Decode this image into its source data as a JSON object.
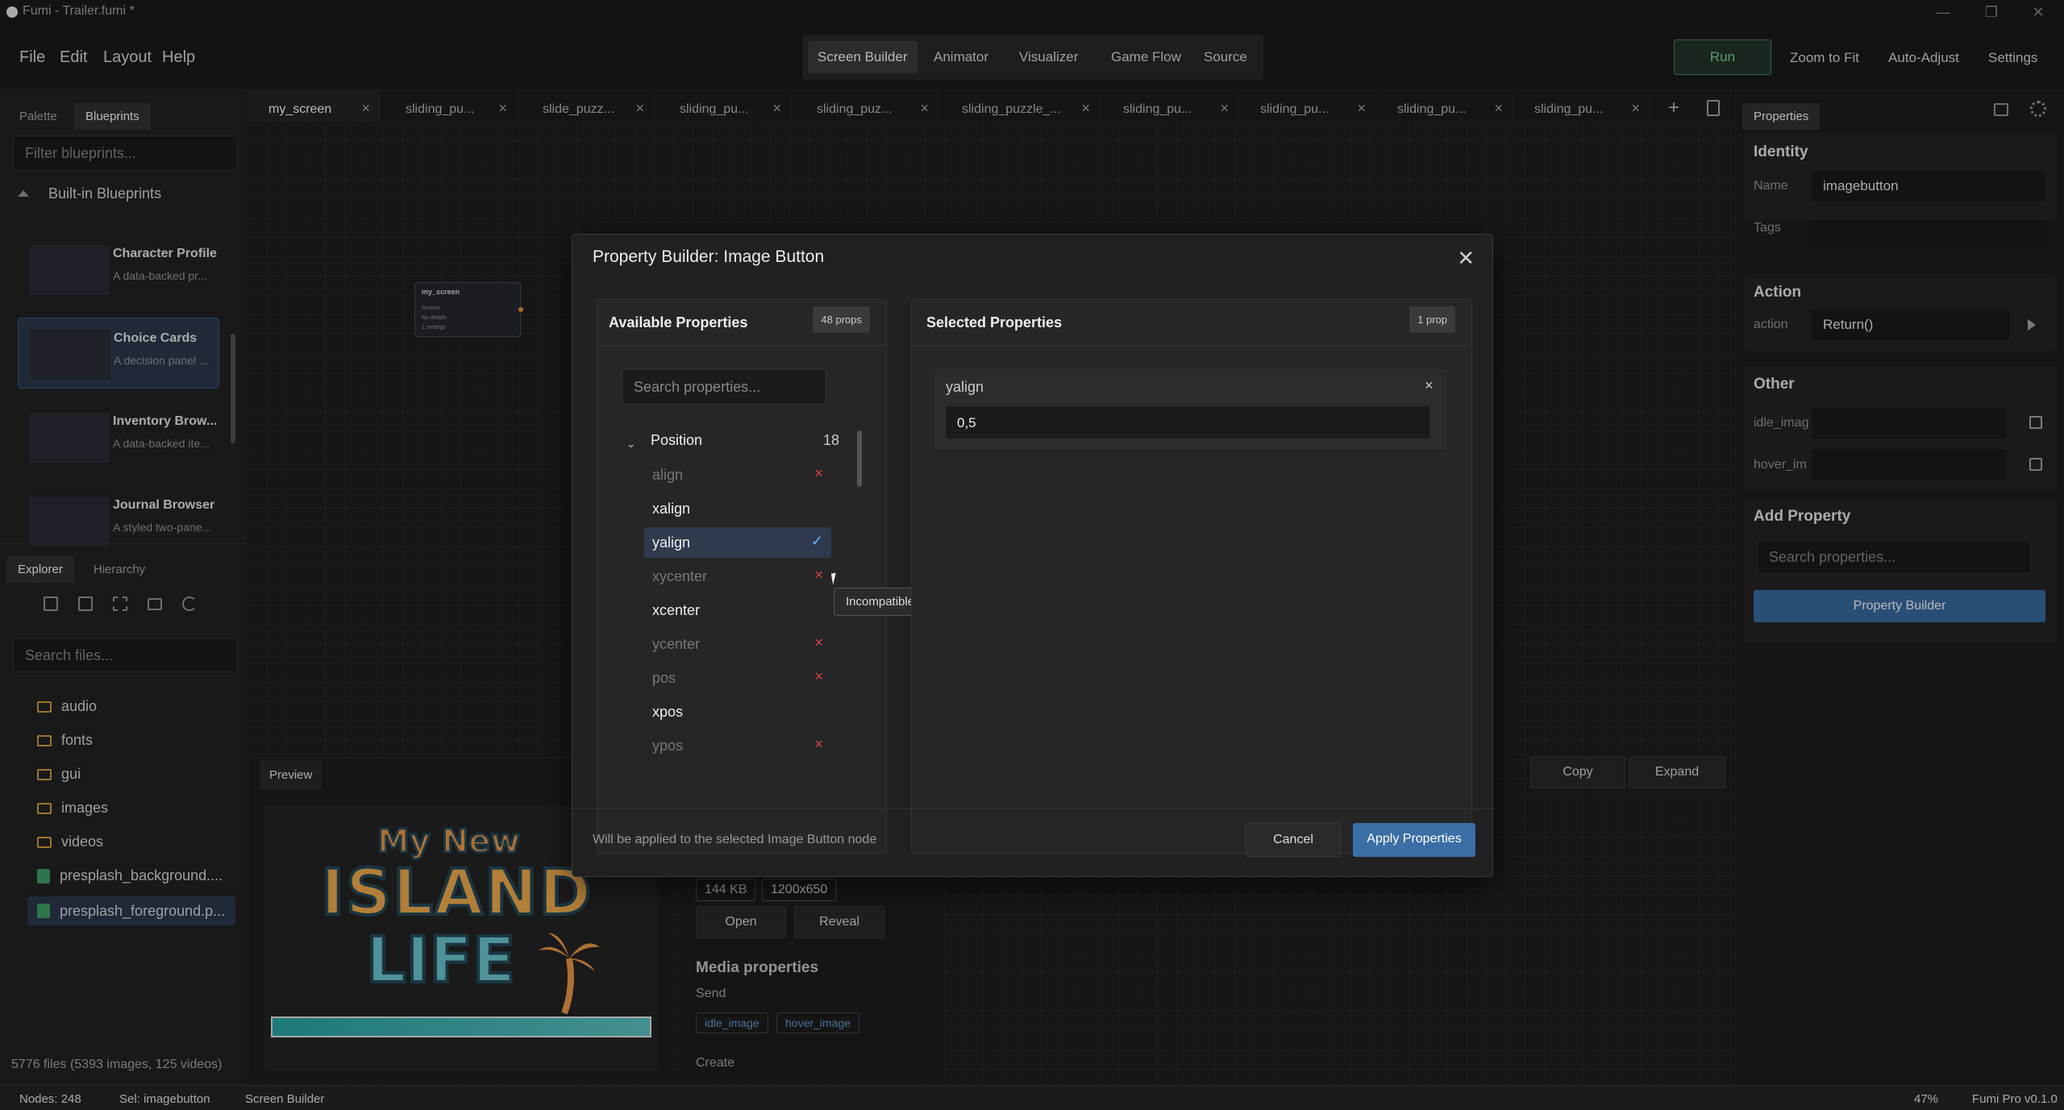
{
  "window": {
    "title": "Fumi - Trailer.fumi *",
    "minimize": "—",
    "maximize": "❐",
    "close": "✕"
  },
  "menu": {
    "items": [
      "File",
      "Edit",
      "Layout",
      "Help"
    ]
  },
  "modes": {
    "tabs": [
      "Screen Builder",
      "Animator",
      "Visualizer",
      "Game Flow",
      "Source"
    ],
    "active": "Screen Builder"
  },
  "toolbar": {
    "run": "Run",
    "zoom": "Zoom to Fit",
    "auto": "Auto-Adjust",
    "settings": "Settings"
  },
  "left": {
    "tabs": [
      "Palette",
      "Blueprints"
    ],
    "filter_placeholder": "Filter blueprints...",
    "group": "Built-in Blueprints",
    "cards": [
      {
        "title": "Character Profile",
        "desc": "A data-backed pr..."
      },
      {
        "title": "Choice Cards",
        "desc": "A decision panel ..."
      },
      {
        "title": "Inventory Brow...",
        "desc": "A data-backed ite..."
      },
      {
        "title": "Journal Browser",
        "desc": "A styled two-pane..."
      }
    ],
    "explorer_tabs": [
      "Explorer",
      "Hierarchy"
    ],
    "search_placeholder": "Search files...",
    "files": [
      {
        "name": "audio",
        "kind": "folder"
      },
      {
        "name": "fonts",
        "kind": "folder"
      },
      {
        "name": "gui",
        "kind": "folder"
      },
      {
        "name": "images",
        "kind": "folder"
      },
      {
        "name": "videos",
        "kind": "folder"
      },
      {
        "name": "presplash_background....",
        "kind": "file"
      },
      {
        "name": "presplash_foreground.p...",
        "kind": "file"
      }
    ],
    "summary": "5776 files (5393 images, 125 videos)"
  },
  "editor_tabs": [
    "my_screen",
    "sliding_pu...",
    "slide_puzz...",
    "sliding_pu...",
    "sliding_puz...",
    "sliding_puzzle_...",
    "sliding_pu...",
    "sliding_pu...",
    "sliding_pu...",
    "sliding_pu..."
  ],
  "node": {
    "title": "my_screen",
    "lines": [
      "Screen",
      "No details",
      "1 settings"
    ]
  },
  "preview": {
    "tab": "Preview",
    "logo_line1": "My New",
    "logo_line2": "ISLAND",
    "logo_line3": "LIFE",
    "copy": "Copy",
    "expand": "Expand"
  },
  "info": {
    "size": "144 KB",
    "dims": "1200x650",
    "open": "Open",
    "reveal": "Reveal",
    "media_title": "Media properties",
    "send": "Send",
    "chips": [
      "idle_image",
      "hover_image"
    ],
    "create": "Create"
  },
  "modal": {
    "title": "Property Builder: Image Button",
    "available_title": "Available Properties",
    "available_count": "48 props",
    "search_placeholder": "Search properties...",
    "group": "Position",
    "group_count": "18",
    "rows": [
      {
        "name": "align",
        "state": "disabled"
      },
      {
        "name": "xalign",
        "state": "enabled"
      },
      {
        "name": "yalign",
        "state": "selected"
      },
      {
        "name": "xycenter",
        "state": "disabled"
      },
      {
        "name": "xcenter",
        "state": "enabled"
      },
      {
        "name": "ycenter",
        "state": "disabled"
      },
      {
        "name": "pos",
        "state": "disabled"
      },
      {
        "name": "xpos",
        "state": "enabled"
      },
      {
        "name": "ypos",
        "state": "disabled"
      }
    ],
    "tooltip": "Incompatible with: yalign",
    "selected_title": "Selected Properties",
    "selected_count": "1 prop",
    "selected_prop": {
      "name": "yalign",
      "value": "0,5"
    },
    "footer_note": "Will be applied to the selected Image Button node",
    "cancel": "Cancel",
    "apply": "Apply Properties"
  },
  "right": {
    "tab": "Properties",
    "identity": {
      "title": "Identity",
      "name_label": "Name",
      "name_value": "imagebutton",
      "tags_label": "Tags"
    },
    "action": {
      "title": "Action",
      "label": "action",
      "value": "Return()"
    },
    "other": {
      "title": "Other",
      "idle_label": "idle_imag",
      "hover_label": "hover_im"
    },
    "add": {
      "title": "Add Property",
      "placeholder": "Search properties...",
      "button": "Property Builder"
    }
  },
  "status": {
    "nodes": "Nodes: 248",
    "sel": "Sel: imagebutton",
    "mode": "Screen Builder",
    "zoom": "47%",
    "version": "Fumi Pro v0.1.0"
  },
  "colors": {
    "accent": "#3a6ea5",
    "run_green": "#7ed89a",
    "danger": "#dd4444",
    "check": "#69b4ff"
  }
}
